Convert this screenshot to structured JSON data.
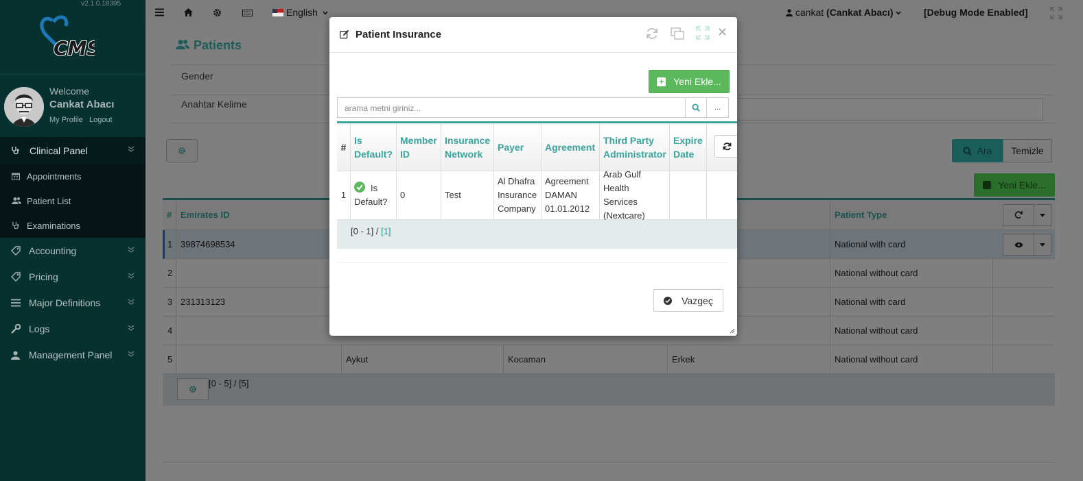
{
  "app": {
    "version": "v2.1.0.18395",
    "logo_text": "CMS"
  },
  "profile": {
    "welcome": "Welcome",
    "name": "Cankat Abacı",
    "my_profile": "My Profile",
    "logout": "Logout"
  },
  "sidebar": {
    "clinical_panel": "Clinical Panel",
    "clinical_items": [
      "Appointments",
      "Patient List",
      "Examinations"
    ],
    "items": [
      "Accounting",
      "Pricing",
      "Major Definitions",
      "Logs",
      "Management Panel"
    ]
  },
  "topbar": {
    "language": "English",
    "user_login": "cankat",
    "user_full": "(Cankat Abacı)",
    "debug": "[Debug Mode Enabled]"
  },
  "page": {
    "title": "Patients",
    "filter_gender": "Gender",
    "filter_keyword": "Anahtar Kelime",
    "search_button": "Ara",
    "clear_button": "Temizle",
    "add_button": "Yeni Ekle...",
    "table": {
      "headers": [
        "#",
        "Emirates ID",
        "Patient Type"
      ],
      "rows": [
        {
          "no": "1",
          "emirates_id": "39874698534",
          "name": "",
          "surname": "",
          "gender": "",
          "type": "National with card"
        },
        {
          "no": "2",
          "emirates_id": "",
          "name": "",
          "surname": "",
          "gender": "",
          "type": "National without card"
        },
        {
          "no": "3",
          "emirates_id": "231313123",
          "name": "",
          "surname": "",
          "gender": "",
          "type": "National with card"
        },
        {
          "no": "4",
          "emirates_id": "",
          "name": "",
          "surname": "",
          "gender": "",
          "type": "National without card"
        },
        {
          "no": "5",
          "emirates_id": "",
          "name": "Aykut",
          "surname": "Kocaman",
          "gender": "Erkek",
          "type": "National without card"
        }
      ],
      "pager": "[0 - 5] / [5]"
    }
  },
  "modal": {
    "title": "Patient Insurance",
    "add_button": "Yeni Ekle...",
    "search_placeholder": "arama metni giriniz...",
    "dots": "...",
    "headers": {
      "no": "#",
      "is_default": "Is Default?",
      "member_id": "Member ID",
      "insurance_network": "Insurance Network",
      "payer": "Payer",
      "agreement": "Agreement",
      "tpa": "Third Party Administrator",
      "expire_date": "Expire Date"
    },
    "rows": [
      {
        "no": "1",
        "is_default": "Is Default?",
        "member_id": "0",
        "insurance_network": "Test",
        "payer": "Al Dhafra Insurance Company",
        "agreement": "Agreement DAMAN 01.01.2012",
        "tpa": "Arab Gulf Health Services (Nextcare)",
        "expire_date": ""
      }
    ],
    "pager_range": "[0 - 1]",
    "pager_sep": " / ",
    "pager_total": "[1]",
    "cancel_button": "Vazgeç"
  },
  "colors": {
    "teal": "#3aa39c",
    "green": "#5cb85c",
    "sidebar": "#06312f"
  }
}
